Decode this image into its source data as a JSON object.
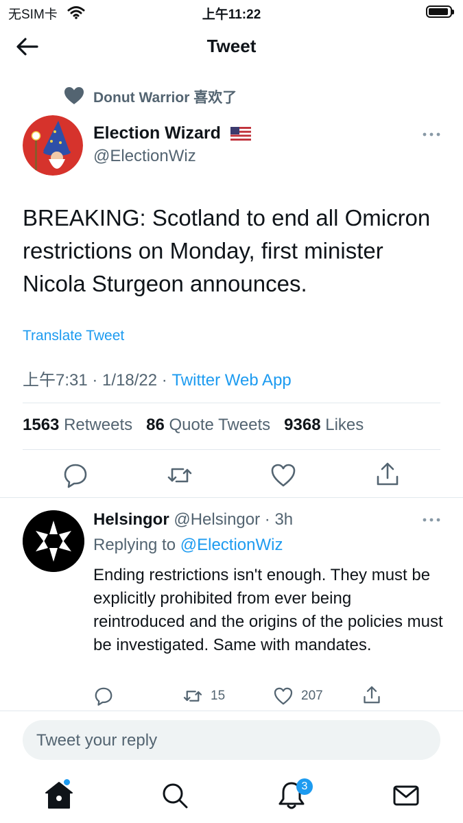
{
  "status_bar": {
    "carrier": "无SIM卡",
    "time": "上午11:22"
  },
  "header": {
    "title": "Tweet"
  },
  "social_context": {
    "text": "Donut Warrior 喜欢了"
  },
  "tweet": {
    "author_name": "Election Wizard",
    "author_handle": "@ElectionWiz",
    "text": "BREAKING: Scotland to end all Omicron restrictions on Monday, first minister Nicola Sturgeon announces.",
    "translate_label": "Translate Tweet",
    "time": "上午7:31",
    "date": "1/18/22",
    "source": "Twitter Web App",
    "stats": {
      "retweets_count": "1563",
      "retweets_label": "Retweets",
      "quotes_count": "86",
      "quotes_label": "Quote Tweets",
      "likes_count": "9368",
      "likes_label": "Likes"
    }
  },
  "reply": {
    "author_name": "Helsingor",
    "author_handle": "@Helsingor",
    "age": "3h",
    "replying_prefix": "Replying to",
    "replying_to": "@ElectionWiz",
    "text": "Ending restrictions isn't enough.  They must be explicitly prohibited from ever being reintroduced and the origins of the policies must be investigated.  Same with mandates.",
    "retweets": "15",
    "likes": "207"
  },
  "composer": {
    "placeholder": "Tweet your reply"
  },
  "tab_bar": {
    "notifications_badge": "3"
  },
  "colors": {
    "accent": "#1d9bf0",
    "secondary_text": "#536471",
    "divider": "#e1e8ed"
  },
  "icons": [
    "wifi-icon",
    "battery-icon",
    "back-arrow-icon",
    "heart-icon",
    "flag-us-icon",
    "more-icon",
    "reply-icon",
    "retweet-icon",
    "like-icon",
    "share-icon",
    "home-icon",
    "search-icon",
    "bell-icon",
    "mail-icon"
  ]
}
